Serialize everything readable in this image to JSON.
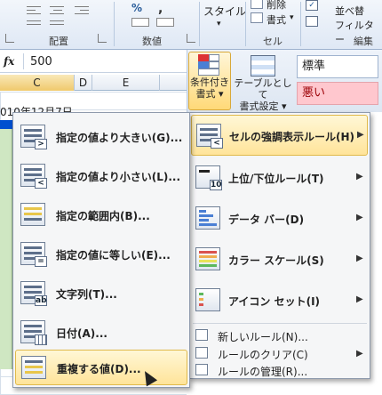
{
  "ribbon": {
    "groups": {
      "alignment": "配置",
      "number": "数値",
      "styles": "スタイル",
      "cells": "セル",
      "editing": "編集"
    },
    "style_button": "スタイル",
    "delete_label": "削除",
    "format_label": "書式",
    "sort_line1": "並べ替",
    "sort_line2": "フィルター",
    "percent_symbol": "%",
    "comma_symbol": ","
  },
  "formula_bar": {
    "fx_label": "fx",
    "value": "500"
  },
  "sheet": {
    "columns": [
      "C",
      "D",
      "E"
    ],
    "partial_cell_text": "010年12月7日"
  },
  "styles_panel": {
    "conditional_formatting_line1": "条件付き",
    "conditional_formatting_line2": "書式 ▾",
    "format_as_table_line1": "テーブルとして",
    "format_as_table_line2": "書式設定 ▾",
    "cell_style_normal": "標準",
    "cell_style_bad": "悪い"
  },
  "submenu": {
    "items": [
      {
        "label": "指定の値より大きい(G)...",
        "icon": "greater-than-icon"
      },
      {
        "label": "指定の値より小さい(L)...",
        "icon": "less-than-icon"
      },
      {
        "label": "指定の範囲内(B)...",
        "icon": "between-icon"
      },
      {
        "label": "指定の値に等しい(E)...",
        "icon": "equal-to-icon"
      },
      {
        "label": "文字列(T)...",
        "icon": "text-contains-icon"
      },
      {
        "label": "日付(A)...",
        "icon": "date-occurring-icon"
      },
      {
        "label": "重複する値(D)...",
        "icon": "duplicate-values-icon"
      }
    ]
  },
  "main_menu": {
    "items": [
      {
        "label": "セルの強調表示ルール(H)",
        "icon": "highlight-cells-icon"
      },
      {
        "label": "上位/下位ルール(T)",
        "icon": "top-bottom-icon"
      },
      {
        "label": "データ バー(D)",
        "icon": "data-bars-icon"
      },
      {
        "label": "カラー スケール(S)",
        "icon": "color-scales-icon"
      },
      {
        "label": "アイコン セット(I)",
        "icon": "icon-sets-icon"
      }
    ],
    "small_items": [
      {
        "label": "新しいルール(N)...",
        "icon": "new-rule-icon"
      },
      {
        "label": "ルールのクリア(C)",
        "icon": "clear-rules-icon"
      },
      {
        "label": "ルールの管理(R)...",
        "icon": "manage-rules-icon"
      }
    ]
  },
  "colors": {
    "hover_bg": "#ffe49a",
    "bad_style": "#ffc7ce",
    "sheet_green": "#cfe7c2"
  }
}
